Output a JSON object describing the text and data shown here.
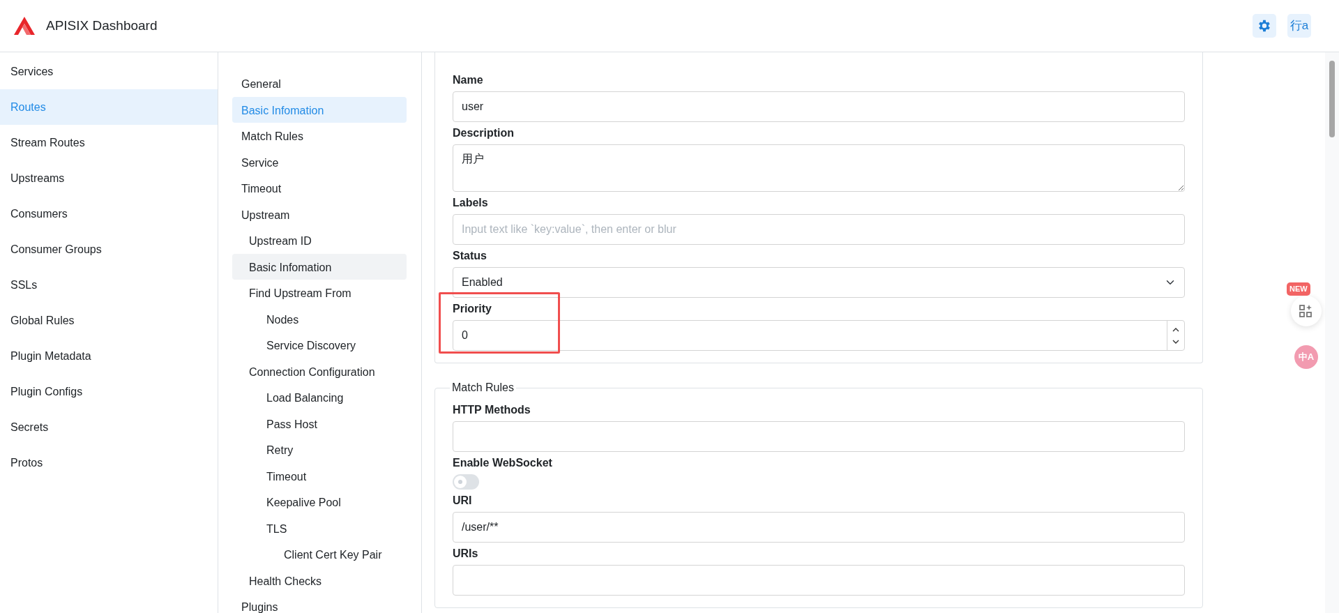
{
  "header": {
    "title": "APISIX Dashboard"
  },
  "header_actions": [
    {
      "kind": "settings"
    },
    {
      "kind": "translate",
      "label": "行a"
    }
  ],
  "sidebar": {
    "items": [
      {
        "label": "Services",
        "selected": false
      },
      {
        "label": "Routes",
        "selected": true
      },
      {
        "label": "Stream Routes",
        "selected": false
      },
      {
        "label": "Upstreams",
        "selected": false
      },
      {
        "label": "Consumers",
        "selected": false
      },
      {
        "label": "Consumer Groups",
        "selected": false
      },
      {
        "label": "SSLs",
        "selected": false
      },
      {
        "label": "Global Rules",
        "selected": false
      },
      {
        "label": "Plugin Metadata",
        "selected": false
      },
      {
        "label": "Plugin Configs",
        "selected": false
      },
      {
        "label": "Secrets",
        "selected": false
      },
      {
        "label": "Protos",
        "selected": false
      }
    ]
  },
  "toc": [
    {
      "label": "General",
      "selected": false,
      "highlighted": false
    },
    {
      "label": "Basic Infomation",
      "selected": true,
      "highlighted": false
    },
    {
      "label": "Match Rules",
      "selected": false,
      "highlighted": false
    },
    {
      "label": "Service",
      "selected": false,
      "highlighted": false
    },
    {
      "label": "Timeout",
      "selected": false,
      "highlighted": false
    },
    {
      "label": "Upstream",
      "selected": false,
      "highlighted": false,
      "children": [
        {
          "label": "Upstream ID",
          "selected": false,
          "highlighted": false
        },
        {
          "label": "Basic Infomation",
          "selected": false,
          "highlighted": true
        },
        {
          "label": "Find Upstream From",
          "selected": false,
          "highlighted": false,
          "children": [
            {
              "label": "Nodes",
              "selected": false,
              "highlighted": false
            },
            {
              "label": "Service Discovery",
              "selected": false,
              "highlighted": false
            }
          ]
        },
        {
          "label": "Connection Configuration",
          "selected": false,
          "highlighted": false,
          "children": [
            {
              "label": "Load Balancing",
              "selected": false,
              "highlighted": false
            },
            {
              "label": "Pass Host",
              "selected": false,
              "highlighted": false
            },
            {
              "label": "Retry",
              "selected": false,
              "highlighted": false
            },
            {
              "label": "Timeout",
              "selected": false,
              "highlighted": false
            },
            {
              "label": "Keepalive Pool",
              "selected": false,
              "highlighted": false
            },
            {
              "label": "TLS",
              "selected": false,
              "highlighted": false,
              "children": [
                {
                  "label": "Client Cert Key Pair",
                  "selected": false,
                  "highlighted": false
                }
              ]
            }
          ]
        },
        {
          "label": "Health Checks",
          "selected": false,
          "highlighted": false
        }
      ]
    },
    {
      "label": "Plugins",
      "selected": false,
      "highlighted": false
    }
  ],
  "sections": [
    {
      "fields": [
        {
          "kind": "text",
          "label": "Name",
          "value": "user"
        },
        {
          "kind": "textarea",
          "label": "Description",
          "value": "用户"
        },
        {
          "kind": "text",
          "label": "Labels",
          "placeholder": "Input text like `key:value`, then enter or blur"
        },
        {
          "kind": "select",
          "label": "Status",
          "value": "Enabled"
        },
        {
          "kind": "number",
          "label": "Priority",
          "value": "0",
          "annotated": true
        }
      ]
    },
    {
      "legend": "Match Rules",
      "fields": [
        {
          "kind": "text",
          "label": "HTTP Methods"
        },
        {
          "kind": "switch",
          "label": "Enable WebSocket",
          "on": false
        },
        {
          "kind": "text",
          "label": "URI",
          "value": "/user/**"
        },
        {
          "kind": "text",
          "label": "URIs"
        }
      ]
    }
  ],
  "floaters": [
    {
      "kind": "apps",
      "badge": "NEW"
    },
    {
      "kind": "translate",
      "label": "中A"
    }
  ]
}
